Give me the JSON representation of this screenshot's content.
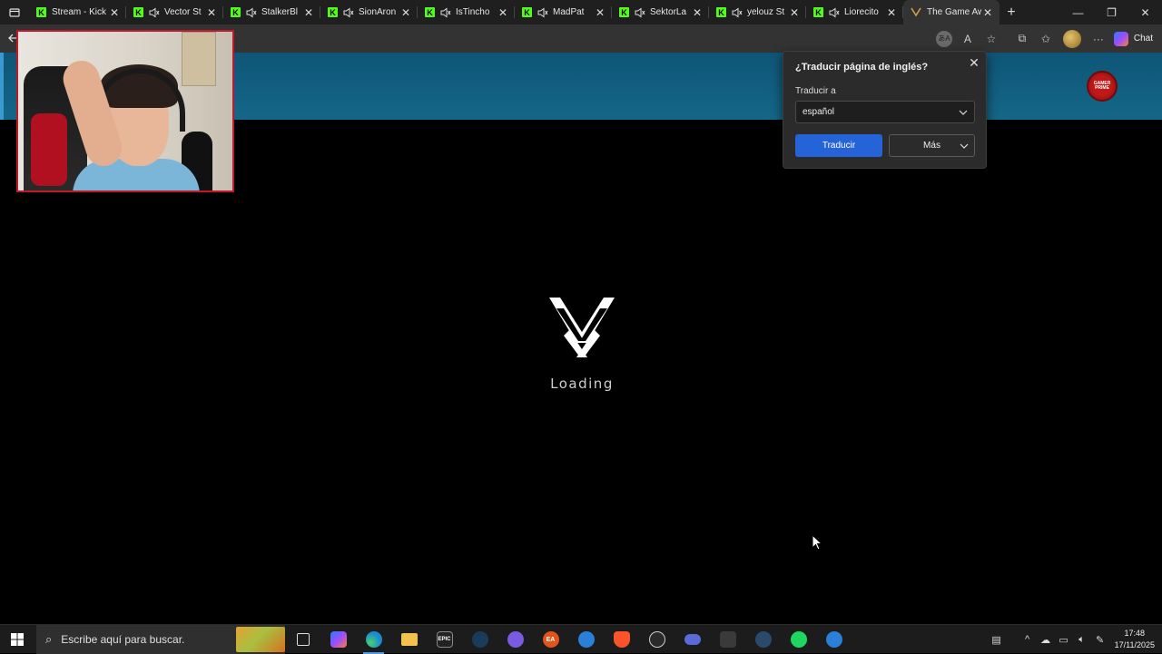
{
  "tabs": [
    {
      "label": "Stream - Kick",
      "muted": false
    },
    {
      "label": "Vector St",
      "muted": true
    },
    {
      "label": "StalkerBl",
      "muted": true
    },
    {
      "label": "SionAron",
      "muted": true
    },
    {
      "label": "IsTincho",
      "muted": true
    },
    {
      "label": "MadPat",
      "muted": true
    },
    {
      "label": "SektorLa",
      "muted": true
    },
    {
      "label": "yelouz St",
      "muted": true
    },
    {
      "label": "Liorecito",
      "muted": true
    },
    {
      "label": "The Game Aw",
      "active": true
    }
  ],
  "toolbar": {
    "chat_label": "Chat"
  },
  "site": {
    "loading_text": "Loading",
    "logo_text": "GAMER PRIME"
  },
  "translate_popup": {
    "title": "¿Traducir página de inglés?",
    "target_label": "Traducir a",
    "target_value": "español",
    "translate_button": "Traducir",
    "more_button": "Más"
  },
  "taskbar": {
    "search_placeholder": "Escribe aquí para buscar.",
    "time": "17:48",
    "date": "17/11/2025"
  },
  "colors": {
    "header": "#146788",
    "primary_button": "#2463d8",
    "webcam_border": "#c2182b",
    "kick_green": "#53fc18"
  }
}
